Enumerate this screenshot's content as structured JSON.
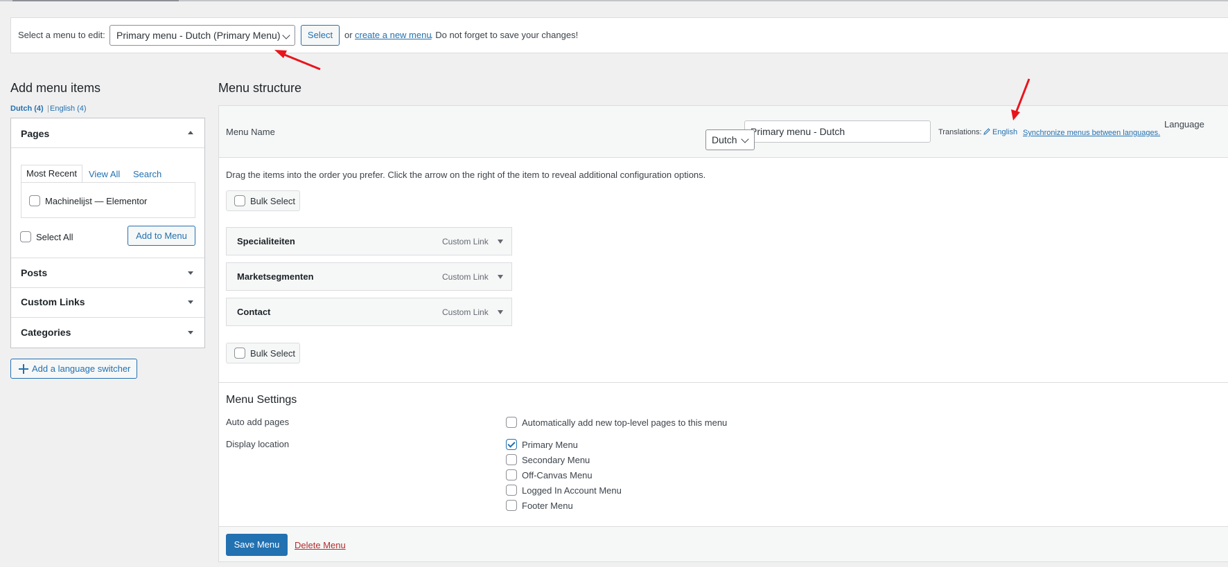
{
  "manage": {
    "label": "Select a menu to edit:",
    "selected_menu": "Primary menu - Dutch (Primary Menu)",
    "select_button": "Select",
    "or_text": "or",
    "create_link": "create a new menu",
    "tail_text": ". Do not forget to save your changes!"
  },
  "left": {
    "heading": "Add menu items",
    "languages": [
      {
        "label": "Dutch (4)",
        "active": true
      },
      {
        "label": "English (4)",
        "active": false
      }
    ],
    "separator": "|",
    "pages": {
      "title": "Pages",
      "tabs": [
        "Most Recent",
        "View All",
        "Search"
      ],
      "items": [
        "Machinelijst — Elementor"
      ],
      "select_all": "Select All",
      "add_button": "Add to Menu"
    },
    "sections": [
      "Posts",
      "Custom Links",
      "Categories"
    ],
    "language_switcher_button": "Add a language switcher"
  },
  "structure": {
    "heading": "Menu structure",
    "menu_name_label": "Menu Name",
    "menu_name_value": "Primary menu - Dutch",
    "language_select": "Dutch",
    "translations_label": "Translations:",
    "translation_link": "English",
    "sync_link": "Synchronize menus between languages.",
    "language_label": "Language",
    "drag_help": "Drag the items into the order you prefer. Click the arrow on the right of the item to reveal additional configuration options.",
    "bulk_select": "Bulk Select",
    "items": [
      {
        "title": "Specialiteiten",
        "type": "Custom Link"
      },
      {
        "title": "Marketsegmenten",
        "type": "Custom Link"
      },
      {
        "title": "Contact",
        "type": "Custom Link"
      }
    ]
  },
  "settings": {
    "heading": "Menu Settings",
    "auto_add_label": "Auto add pages",
    "auto_add_option": {
      "label": "Automatically add new top-level pages to this menu",
      "checked": false
    },
    "display_location_label": "Display location",
    "locations": [
      {
        "label": "Primary Menu",
        "checked": true
      },
      {
        "label": "Secondary Menu",
        "checked": false
      },
      {
        "label": "Off-Canvas Menu",
        "checked": false
      },
      {
        "label": "Logged In Account Menu",
        "checked": false
      },
      {
        "label": "Footer Menu",
        "checked": false
      }
    ]
  },
  "footer": {
    "save_button": "Save Menu",
    "delete_link": "Delete Menu"
  },
  "colors": {
    "accent": "#2271b1",
    "danger": "#b32d2e",
    "annotation_arrow": "#e8141c"
  }
}
